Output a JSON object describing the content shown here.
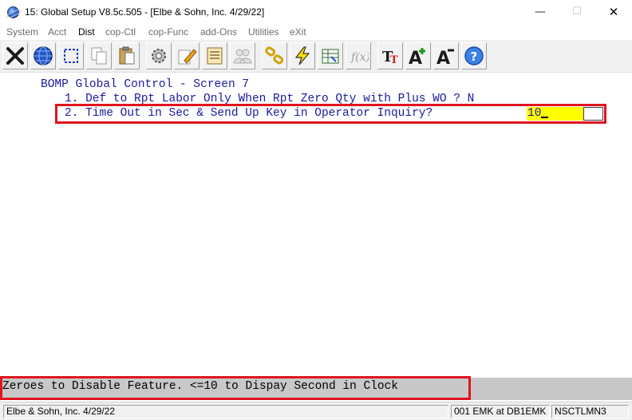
{
  "window": {
    "title": "15: Global Setup V8.5c.505 - [Elbe & Sohn, Inc. 4/29/22]",
    "minimize_glyph": "—",
    "maximize_glyph": "☐",
    "close_glyph": "✕"
  },
  "menu": {
    "items": [
      "System",
      "Acct",
      "Dist",
      "cop-Ctl",
      "cop-Func",
      "add-Ons",
      "Utilities",
      "eXit"
    ],
    "active": "Dist"
  },
  "toolbar": {
    "icons": [
      "close-x-icon",
      "globe-icon",
      "select-icon",
      "copy-icon",
      "paste-icon",
      "settings-gear-icon",
      "edit-pencil-icon",
      "notes-icon",
      "users-icon",
      "link-icon",
      "lightning-icon",
      "spreadsheet-icon",
      "function-icon",
      "font-icon",
      "font-increase-icon",
      "font-decrease-icon",
      "help-icon"
    ]
  },
  "screen": {
    "heading": "BOMP Global Control - Screen 7",
    "rows": [
      {
        "text": "1. Def to Rpt Labor Only When Rpt Zero Qty with Plus WO ? N"
      },
      {
        "text": "2. Time Out in Sec & Send Up Key in Operator Inquiry?",
        "value": "10"
      }
    ],
    "hint": "Zeroes to Disable Feature. <=10 to Dispay Second in Clock"
  },
  "status": {
    "company": "Elbe & Sohn, Inc. 4/29/22",
    "session": "001 EMK at DB1EMK",
    "program": "NSCTLMN3"
  },
  "colors": {
    "terminal_text": "#1a1a9e",
    "field_bg": "#ffff00",
    "highlight": "#e0141e",
    "hint_bg": "#c8c8c8"
  }
}
